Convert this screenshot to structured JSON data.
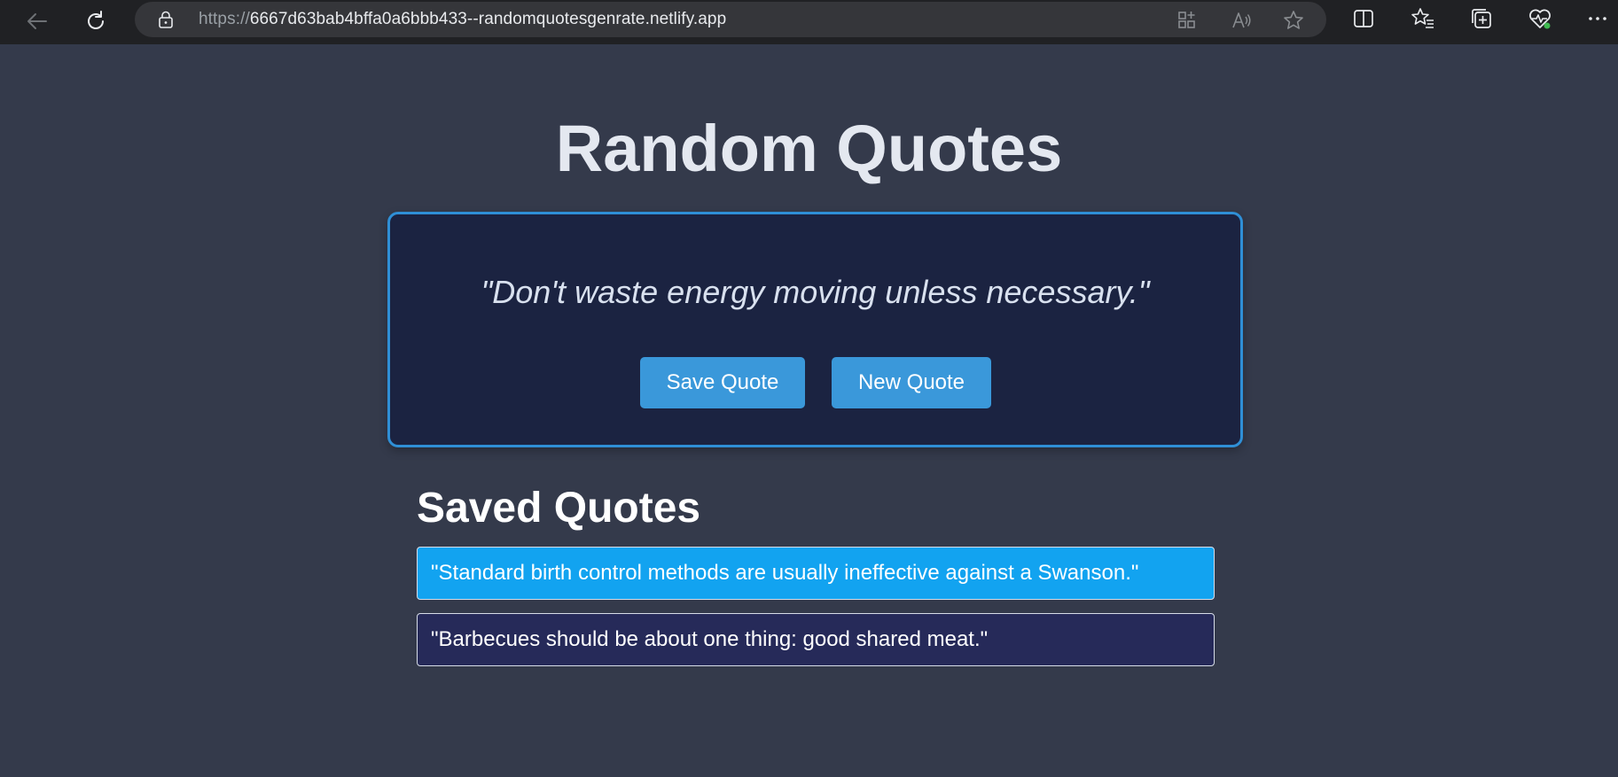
{
  "browser": {
    "url_scheme": "https://",
    "url_rest": "6667d63bab4bffa0a6bbb433--randomquotesgenrate.netlify.app",
    "icons": [
      "back-arrow-icon",
      "refresh-icon",
      "lock-icon",
      "app-available-icon",
      "read-aloud-icon",
      "favorite-star-icon",
      "split-screen-icon",
      "favorites-list-icon",
      "collections-icon",
      "browser-essentials-icon",
      "more-menu-icon"
    ]
  },
  "page": {
    "title": "Random Quotes",
    "current_quote": "\"Don't waste energy moving unless necessary.\"",
    "save_button_label": "Save Quote",
    "new_button_label": "New Quote",
    "saved_heading": "Saved Quotes",
    "saved_quotes": [
      "\"Standard birth control methods are usually ineffective against a Swanson.\"",
      "\"Barbecues should be about one thing: good shared meat.\""
    ]
  },
  "colors": {
    "background": "#343a4b",
    "card_background": "#1b2341",
    "card_border": "#2f8fd6",
    "button": "#3a98da",
    "saved_item_active": "#12a3f0",
    "saved_item": "#262a59"
  }
}
